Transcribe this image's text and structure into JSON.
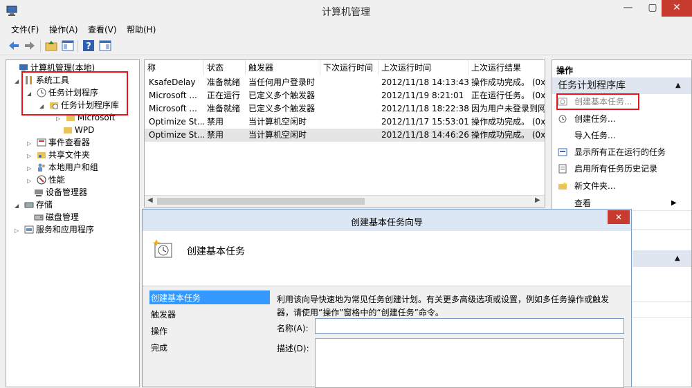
{
  "window": {
    "title": "计算机管理",
    "min": "—",
    "max": "▢",
    "close": "✕"
  },
  "menu": [
    "文件(F)",
    "操作(A)",
    "查看(V)",
    "帮助(H)"
  ],
  "toolbar": [
    "back-arrow-icon",
    "forward-arrow-icon",
    "up-folder-icon",
    "show-hide-tree-icon",
    "help-icon",
    "action-pane-icon"
  ],
  "tree": {
    "root": "计算机管理(本地)",
    "system_tools": "系统工具",
    "task_scheduler": "任务计划程序",
    "task_library": "任务计划程序库",
    "microsoft": "Microsoft",
    "wpd": "WPD",
    "event_viewer": "事件查看器",
    "shared_folders": "共享文件夹",
    "local_users": "本地用户和组",
    "performance": "性能",
    "device_manager": "设备管理器",
    "storage": "存储",
    "disk_mgmt": "磁盘管理",
    "services": "服务和应用程序"
  },
  "list": {
    "columns": [
      "称",
      "状态",
      "触发器",
      "下次运行时间",
      "上次运行时间",
      "上次运行结果"
    ],
    "rows": [
      [
        "KsafeDelay",
        "准备就绪",
        "当任何用户登录时",
        "",
        "2012/11/18 14:13:43",
        "操作成功完成。 (0x"
      ],
      [
        "Microsoft ...",
        "正在运行",
        "已定义多个触发器",
        "",
        "2012/11/19 8:21:01",
        "正在运行任务。 (0x"
      ],
      [
        "Microsoft ...",
        "准备就绪",
        "已定义多个触发器",
        "",
        "2012/11/18 18:22:38",
        "因为用户未登录到网"
      ],
      [
        "Optimize St...",
        "禁用",
        "当计算机空闲时",
        "",
        "2012/11/17 15:53:01",
        "操作成功完成。 (0x"
      ],
      [
        "Optimize St...",
        "禁用",
        "当计算机空闲时",
        "",
        "2012/11/18 14:46:26",
        "操作成功完成。 (0x"
      ]
    ]
  },
  "actions": {
    "header": "操作",
    "section": "任务计划程序库",
    "items": [
      "创建基本任务...",
      "创建任务...",
      "导入任务...",
      "显示所有正在运行的任务",
      "启用所有任务历史记录",
      "新文件夹...",
      "查看"
    ]
  },
  "wizard": {
    "title": "创建基本任务向导",
    "close": "✕",
    "heading": "创建基本任务",
    "steps": [
      "创建基本任务",
      "触发器",
      "操作",
      "完成"
    ],
    "description": "利用该向导快速地为常见任务创建计划。有关更多高级选项或设置，例如多任务操作或触发器，请使用“操作”窗格中的“创建任务”命令。",
    "name_label": "名称(A):",
    "name_value": "",
    "desc_label": "描述(D):",
    "desc_value": ""
  },
  "colors": {
    "highlight_red": "#e8141c",
    "selected_step": "#3399ff",
    "section_bg": "#dfe6ef"
  }
}
